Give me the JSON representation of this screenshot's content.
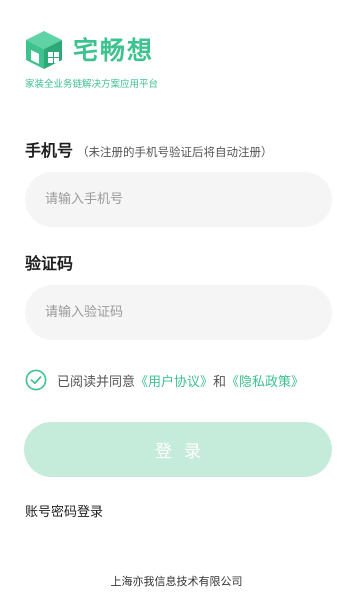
{
  "brand": {
    "name": "宅畅想",
    "slogan": "家装全业务链解决方案应用平台",
    "accent_color": "#3ec28f"
  },
  "phone_field": {
    "label": "手机号",
    "hint": "（未注册的手机号验证后将自动注册）",
    "placeholder": "请输入手机号",
    "value": ""
  },
  "code_field": {
    "label": "验证码",
    "placeholder": "请输入验证码",
    "value": ""
  },
  "agreement": {
    "checked": true,
    "prefix": "已阅读并同意",
    "user_agreement": "《用户协议》",
    "and": "和",
    "privacy_policy": "《隐私政策》",
    "icon": "check-circle-icon"
  },
  "login_button": {
    "label": "登录",
    "enabled": false,
    "color": "#c5ecdb"
  },
  "password_login_link": "账号密码登录",
  "footer": {
    "company": "上海亦我信息技术有限公司"
  }
}
